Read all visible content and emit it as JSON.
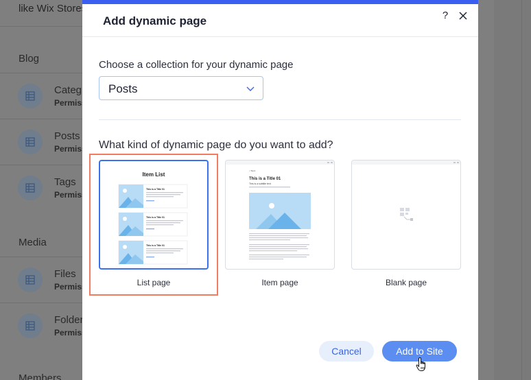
{
  "background": {
    "top_text": "like Wix Stores",
    "sections": [
      {
        "title": "Blog",
        "items": [
          {
            "title": "Categ",
            "sub": "Permiss"
          },
          {
            "title": "Posts",
            "sub": "Permiss"
          },
          {
            "title": "Tags",
            "sub": "Permiss"
          }
        ]
      },
      {
        "title": "Media",
        "items": [
          {
            "title": "Files",
            "sub": "Permiss"
          },
          {
            "title": "Folder",
            "sub": "Permiss"
          }
        ]
      },
      {
        "title": "Members",
        "items": []
      }
    ]
  },
  "modal": {
    "title": "Add dynamic page",
    "help_label": "?",
    "collection_label": "Choose a collection for your dynamic page",
    "collection_value": "Posts",
    "kind_label": "What kind of dynamic page do you want to add?",
    "options": [
      {
        "label": "List page",
        "selected": true
      },
      {
        "label": "Item page",
        "selected": false
      },
      {
        "label": "Blank page",
        "selected": false
      }
    ],
    "list_preview": {
      "title": "Item List",
      "item_title": "This is a Title 01"
    },
    "item_preview": {
      "back": "< Back",
      "title": "This is a Title 01",
      "subtitle": "This is a subtitle text"
    },
    "cancel_label": "Cancel",
    "add_label": "Add to Site"
  },
  "colors": {
    "accent": "#3a5ff0",
    "selection_frame": "#f07d5f",
    "primary_button": "#5c8ef2",
    "secondary_button": "#e7effd",
    "image_placeholder": "#b9dcf6"
  }
}
